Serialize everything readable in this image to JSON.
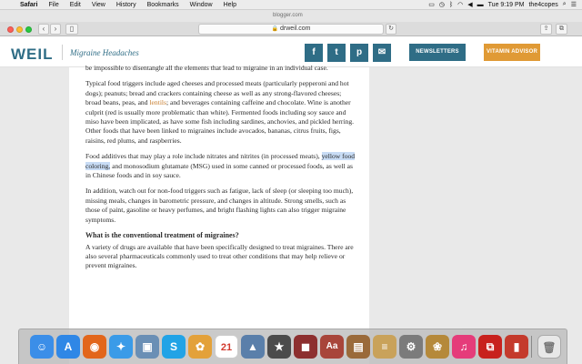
{
  "menubar": {
    "apple_glyph": "",
    "items": [
      "Safari",
      "File",
      "Edit",
      "View",
      "History",
      "Bookmarks",
      "Window",
      "Help"
    ],
    "clock": "Tue 9:19 PM",
    "user": "the4copes"
  },
  "browser": {
    "previous_url": "blogger.com",
    "url": "drweil.com",
    "back_icon": "chevron-left",
    "forward_icon": "chevron-right",
    "sidebar_icon": "sidebar",
    "reload_icon": "reload",
    "share_icon": "share",
    "tabs_icon": "tabs"
  },
  "site": {
    "logo": "WEIL",
    "section_title": "Migraine Headaches",
    "social": [
      "f",
      "t",
      "p",
      "✉"
    ],
    "newsletters_label": "NEWSLETTERS",
    "vitamin_label": "VITAMIN ADVISOR",
    "colors": {
      "brand_blue": "#2f6d86",
      "brand_orange": "#e09a35",
      "link": "#c77d2e",
      "highlight": "#c8dcf5"
    }
  },
  "article": {
    "p0": "be impossible to disentangle all the elements that lead to migraine in an individual case.",
    "p1_a": "Typical food triggers include aged cheeses and processed meats (particularly pepperoni and hot dogs); peanuts; bread and crackers containing cheese as well as any strong-flavored cheeses; broad beans, peas, and ",
    "p1_link": "lentils",
    "p1_b": "; and beverages containing caffeine and chocolate. Wine is another culprit (red is usually more problematic than white). Fermented foods including soy sauce and miso have been implicated, as have some fish including sardines, anchovies, and pickled herring. Other foods that have been linked to migraines include avocados, bananas, citrus fruits, figs, raisins, red plums, and raspberries.",
    "p2_a": "Food additives that may play a role include nitrates and nitrites (in processed meats), ",
    "p2_highlight": "yellow food coloring,",
    "p2_b": " and monosodium glutamate (MSG) used in some canned or processed foods, as well as in Chinese foods and in soy sauce.",
    "p3": "In addition, watch out for non-food triggers such as fatigue, lack of sleep (or sleeping too much), missing meals, changes in barometric pressure, and changes in altitude. Strong smells, such as those of paint, gasoline or heavy perfumes, and bright flashing lights can also trigger migraine symptoms.",
    "heading": "What is the conventional treatment of migraines?",
    "p4": "A variety of drugs are available that have been specifically designed to treat migraines. There are also several pharmaceuticals commonly used to treat other conditions that may help relieve or prevent migraines."
  },
  "dock": {
    "calendar_day": "21",
    "apps": [
      {
        "name": "finder-icon",
        "glyph": "☺",
        "color": "#3b8ee8"
      },
      {
        "name": "app-store-icon",
        "glyph": "A",
        "color": "#2f87e6"
      },
      {
        "name": "firefox-icon",
        "glyph": "◉",
        "color": "#e2661b"
      },
      {
        "name": "safari-icon",
        "glyph": "✦",
        "color": "#3a9be8"
      },
      {
        "name": "preview-icon",
        "glyph": "▣",
        "color": "#6a8fb5"
      },
      {
        "name": "skype-icon",
        "glyph": "S",
        "color": "#21a3e6"
      },
      {
        "name": "photos-icon",
        "glyph": "✿",
        "color": "#e3a13a"
      },
      {
        "name": "calendar-icon",
        "glyph": "",
        "color": "#ffffff"
      },
      {
        "name": "photo-app-icon",
        "glyph": "▲",
        "color": "#5a7faa"
      },
      {
        "name": "imovie-icon",
        "glyph": "★",
        "color": "#4b4b4b"
      },
      {
        "name": "photo-booth-icon",
        "glyph": "◼",
        "color": "#8d2f2f"
      },
      {
        "name": "dictionary-icon",
        "glyph": "Aa",
        "color": "#a8453a"
      },
      {
        "name": "keynote-icon",
        "glyph": "▤",
        "color": "#9a6a3a"
      },
      {
        "name": "textedit-icon",
        "glyph": "≡",
        "color": "#c9a25a"
      },
      {
        "name": "system-preferences-icon",
        "glyph": "⚙",
        "color": "#7b7b7b"
      },
      {
        "name": "gallery-icon",
        "glyph": "❀",
        "color": "#b5893a"
      },
      {
        "name": "itunes-icon",
        "glyph": "♫",
        "color": "#e53c7a"
      },
      {
        "name": "acrobat-icon",
        "glyph": "⧉",
        "color": "#c8211d"
      },
      {
        "name": "pdf-app-icon",
        "glyph": "▮",
        "color": "#c43a2c"
      }
    ],
    "trash_glyph": "🗑"
  }
}
